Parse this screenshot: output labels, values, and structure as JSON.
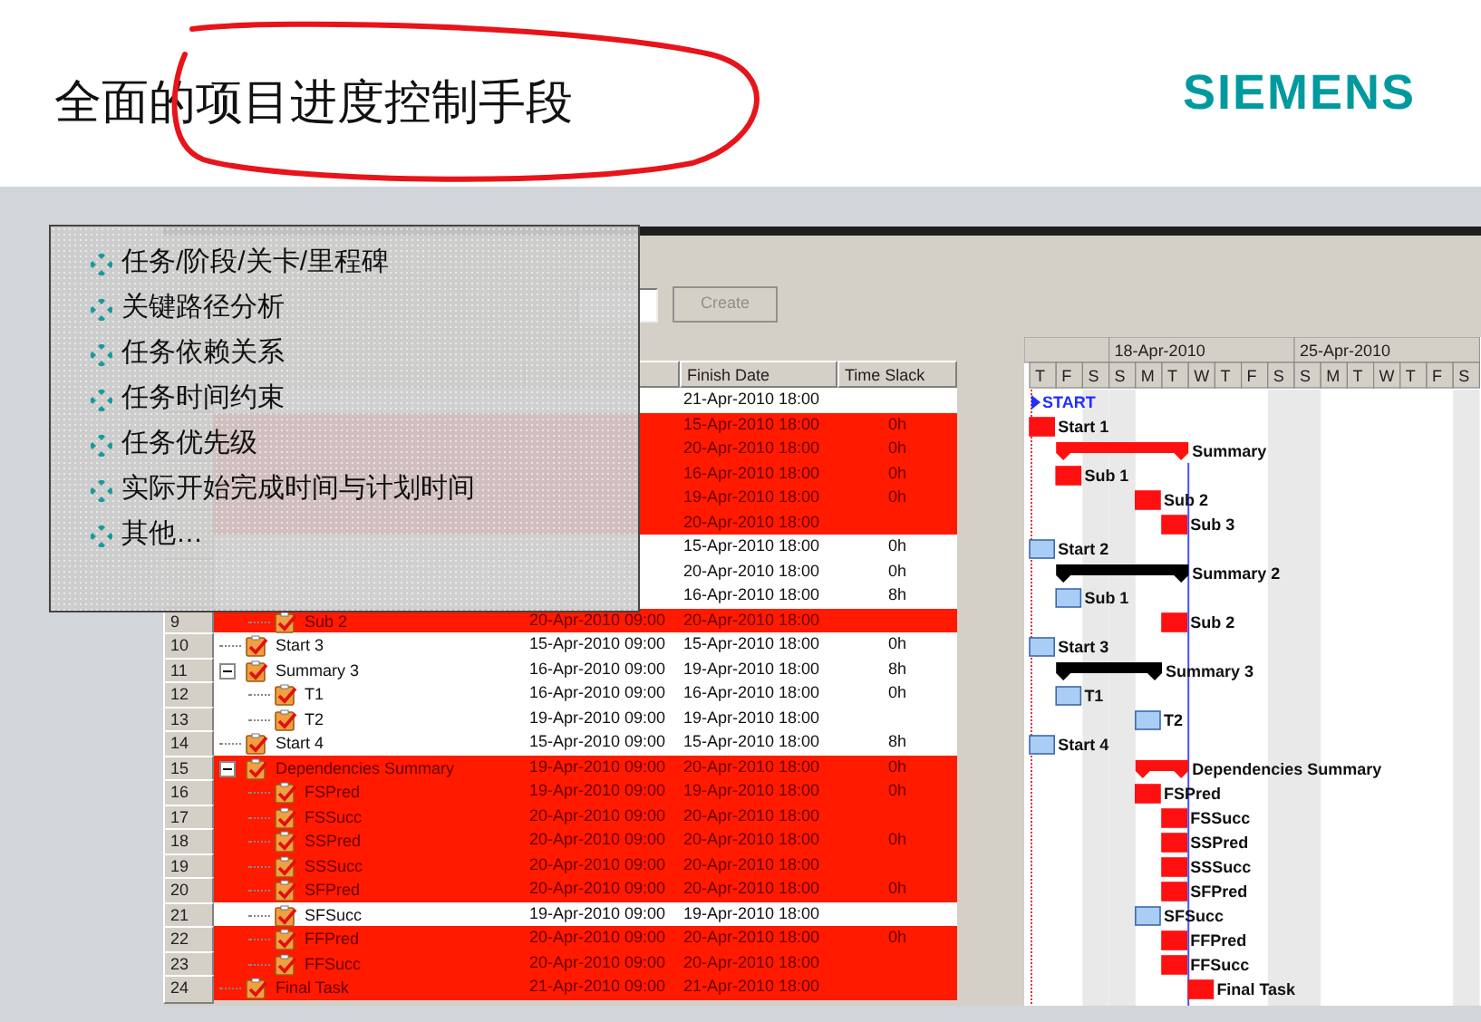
{
  "slide": {
    "title": "全面的项目进度控制手段",
    "logo": "SIEMENS"
  },
  "bullets": [
    {
      "text": "任务/阶段/关卡/里程碑"
    },
    {
      "text": "关键路径分析"
    },
    {
      "text": "任务依赖关系"
    },
    {
      "text": "任务时间约束"
    },
    {
      "text": "任务优先级"
    },
    {
      "text": "实际开始完成时间与计划时间"
    },
    {
      "text": "其他…"
    }
  ],
  "toolbar": {
    "create_button": {
      "label": "Create",
      "disabled": true
    }
  },
  "table": {
    "columns": [
      {
        "label": "Finish Date"
      },
      {
        "label": "Time Slack"
      }
    ],
    "rows": [
      {
        "finish": "21-Apr-2010 18:00",
        "critical": false,
        "kind": "project",
        "bar_label": "START",
        "children": [
          {
            "finish": "15-Apr-2010 18:00",
            "slack": "0h",
            "critical": true,
            "kind": "task",
            "bar_label": "Start 1"
          },
          {
            "finish": "20-Apr-2010 18:00",
            "slack": "0h",
            "critical": true,
            "kind": "summary",
            "bar_label": "Summary",
            "children": [
              {
                "finish": "16-Apr-2010 18:00",
                "slack": "0h",
                "critical": true,
                "kind": "task",
                "bar_label": "Sub 1"
              },
              {
                "finish": "19-Apr-2010 18:00",
                "slack": "0h",
                "critical": true,
                "kind": "task",
                "bar_label": "Sub 2"
              },
              {
                "finish": "20-Apr-2010 18:00",
                "critical": true,
                "kind": "task",
                "bar_label": "Sub 3"
              }
            ]
          },
          {
            "finish": "15-Apr-2010 18:00",
            "slack": "0h",
            "critical": false,
            "kind": "task",
            "bar_label": "Start 2"
          },
          {
            "finish": "20-Apr-2010 18:00",
            "slack": "0h",
            "critical": false,
            "kind": "summary",
            "bar_label": "Summary 2",
            "children": [
              {
                "finish": "16-Apr-2010 18:00",
                "slack": "8h",
                "critical": false,
                "kind": "task",
                "bar_label": "Sub 1"
              },
              {
                "number": "9",
                "name": "Sub 2",
                "start": "20-Apr-2010 09:00",
                "finish": "20-Apr-2010 18:00",
                "critical": true,
                "kind": "task",
                "bar_label": "Sub 2"
              }
            ]
          },
          {
            "number": "10",
            "name": "Start 3",
            "start": "15-Apr-2010 09:00",
            "finish": "15-Apr-2010 18:00",
            "slack": "0h",
            "critical": false,
            "kind": "task",
            "bar_label": "Start 3"
          },
          {
            "number": "11",
            "name": "Summary 3",
            "start": "16-Apr-2010 09:00",
            "finish": "19-Apr-2010 18:00",
            "slack": "8h",
            "critical": false,
            "kind": "summary",
            "expanded": true,
            "bar_label": "Summary 3",
            "children": [
              {
                "number": "12",
                "name": "T1",
                "start": "16-Apr-2010 09:00",
                "finish": "16-Apr-2010 18:00",
                "slack": "0h",
                "critical": false,
                "kind": "task",
                "bar_label": "T1"
              },
              {
                "number": "13",
                "name": "T2",
                "start": "19-Apr-2010 09:00",
                "finish": "19-Apr-2010 18:00",
                "critical": false,
                "kind": "task",
                "bar_label": "T2"
              }
            ]
          },
          {
            "number": "14",
            "name": "Start 4",
            "start": "15-Apr-2010 09:00",
            "finish": "15-Apr-2010 18:00",
            "slack": "8h",
            "critical": false,
            "kind": "task",
            "bar_label": "Start 4"
          },
          {
            "number": "15",
            "name": "Dependencies Summary",
            "start": "19-Apr-2010 09:00",
            "finish": "20-Apr-2010 18:00",
            "slack": "0h",
            "critical": true,
            "kind": "summary",
            "expanded": true,
            "bar_label": "Dependencies Summary",
            "children": [
              {
                "number": "16",
                "name": "FSPred",
                "start": "19-Apr-2010 09:00",
                "finish": "19-Apr-2010 18:00",
                "slack": "0h",
                "critical": true,
                "kind": "task",
                "bar_label": "FSPred"
              },
              {
                "number": "17",
                "name": "FSSucc",
                "start": "20-Apr-2010 09:00",
                "finish": "20-Apr-2010 18:00",
                "critical": true,
                "kind": "task",
                "bar_label": "FSSucc"
              },
              {
                "number": "18",
                "name": "SSPred",
                "start": "20-Apr-2010 09:00",
                "finish": "20-Apr-2010 18:00",
                "slack": "0h",
                "critical": true,
                "kind": "task",
                "bar_label": "SSPred"
              },
              {
                "number": "19",
                "name": "SSSucc",
                "start": "20-Apr-2010 09:00",
                "finish": "20-Apr-2010 18:00",
                "critical": true,
                "kind": "task",
                "bar_label": "SSSucc"
              },
              {
                "number": "20",
                "name": "SFPred",
                "start": "20-Apr-2010 09:00",
                "finish": "20-Apr-2010 18:00",
                "slack": "0h",
                "critical": true,
                "kind": "task",
                "bar_label": "SFPred"
              },
              {
                "number": "21",
                "name": "SFSucc",
                "start": "19-Apr-2010 09:00",
                "finish": "19-Apr-2010 18:00",
                "critical": false,
                "kind": "task",
                "bar_label": "SFSucc"
              },
              {
                "number": "22",
                "name": "FFPred",
                "start": "20-Apr-2010 09:00",
                "finish": "20-Apr-2010 18:00",
                "slack": "0h",
                "critical": true,
                "kind": "task",
                "bar_label": "FFPred"
              },
              {
                "number": "23",
                "name": "FFSucc",
                "start": "20-Apr-2010 09:00",
                "finish": "20-Apr-2010 18:00",
                "critical": true,
                "kind": "task",
                "bar_label": "FFSucc"
              }
            ]
          },
          {
            "number": "24",
            "name": "Final Task",
            "start": "21-Apr-2010 09:00",
            "finish": "21-Apr-2010 18:00",
            "critical": true,
            "kind": "task",
            "bar_label": "Final Task"
          }
        ]
      }
    ]
  },
  "gantt": {
    "weeks": [
      {
        "label": "18-Apr-2010"
      },
      {
        "label": "25-Apr-2010"
      }
    ],
    "days": [
      {
        "label": "T",
        "weekend": false
      },
      {
        "label": "F",
        "weekend": false
      },
      {
        "label": "S",
        "weekend": true
      },
      {
        "label": "S",
        "weekend": true
      },
      {
        "label": "M",
        "weekend": false
      },
      {
        "label": "T",
        "weekend": false
      },
      {
        "label": "W",
        "weekend": false
      },
      {
        "label": "T",
        "weekend": false
      },
      {
        "label": "F",
        "weekend": false
      },
      {
        "label": "S",
        "weekend": true
      },
      {
        "label": "S",
        "weekend": true
      },
      {
        "label": "M",
        "weekend": false
      },
      {
        "label": "T",
        "weekend": false
      },
      {
        "label": "W",
        "weekend": false
      },
      {
        "label": "T",
        "weekend": false
      },
      {
        "label": "F",
        "weekend": false
      },
      {
        "label": "S",
        "weekend": true
      }
    ]
  }
}
